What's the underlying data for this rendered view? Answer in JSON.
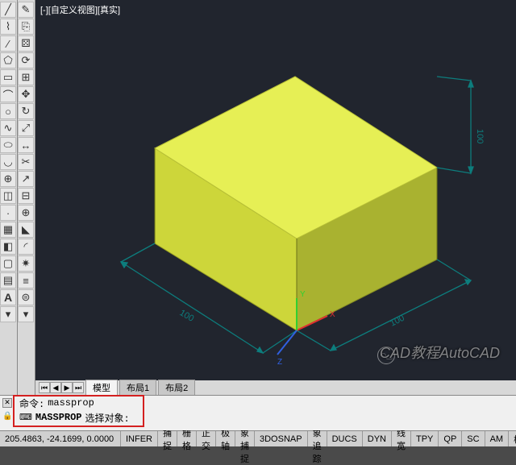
{
  "view_label": "[-][自定义视图][真实]",
  "toolbar_left": [
    "line",
    "polyline",
    "spline",
    "circle",
    "arc",
    "point",
    "text",
    "dim",
    "hatch",
    "trim",
    "offset",
    "move",
    "copy",
    "rotate",
    "mirror",
    "scale",
    "array",
    "fillet",
    "Aicon"
  ],
  "toolbar_left2": [
    "layer",
    "explode",
    "block",
    "measure",
    "dimlin",
    "prop",
    "match",
    "zoom",
    "pan",
    "orbit",
    "regen",
    "styles",
    "render",
    "ucs",
    "box",
    "cyl",
    "sphere",
    "region",
    "list",
    "plot",
    "opts"
  ],
  "tab_nav": [
    "⏮",
    "◀",
    "▶",
    "⏭"
  ],
  "tabs": [
    {
      "label": "模型",
      "active": true
    },
    {
      "label": "布局1",
      "active": false
    },
    {
      "label": "布局2",
      "active": false
    }
  ],
  "cmd": {
    "prefix": "命令:",
    "text": "massprop",
    "prompt_prefix": "MASSPROP",
    "prompt": "选择对象:"
  },
  "status": {
    "coords": "205.4863, -24.1699, 0.0000",
    "buttons": [
      "INFER",
      "捕捉",
      "栅格",
      "正交",
      "极轴",
      "对象捕捉",
      "3DOSNAP",
      "对象追踪",
      "DUCS",
      "DYN",
      "线宽",
      "TPY",
      "QP",
      "SC",
      "AM",
      "模"
    ]
  },
  "watermark": "CAD教程AutoCAD",
  "cube": {
    "dim_x": "100",
    "dim_y": "100",
    "dim_z": "100"
  }
}
